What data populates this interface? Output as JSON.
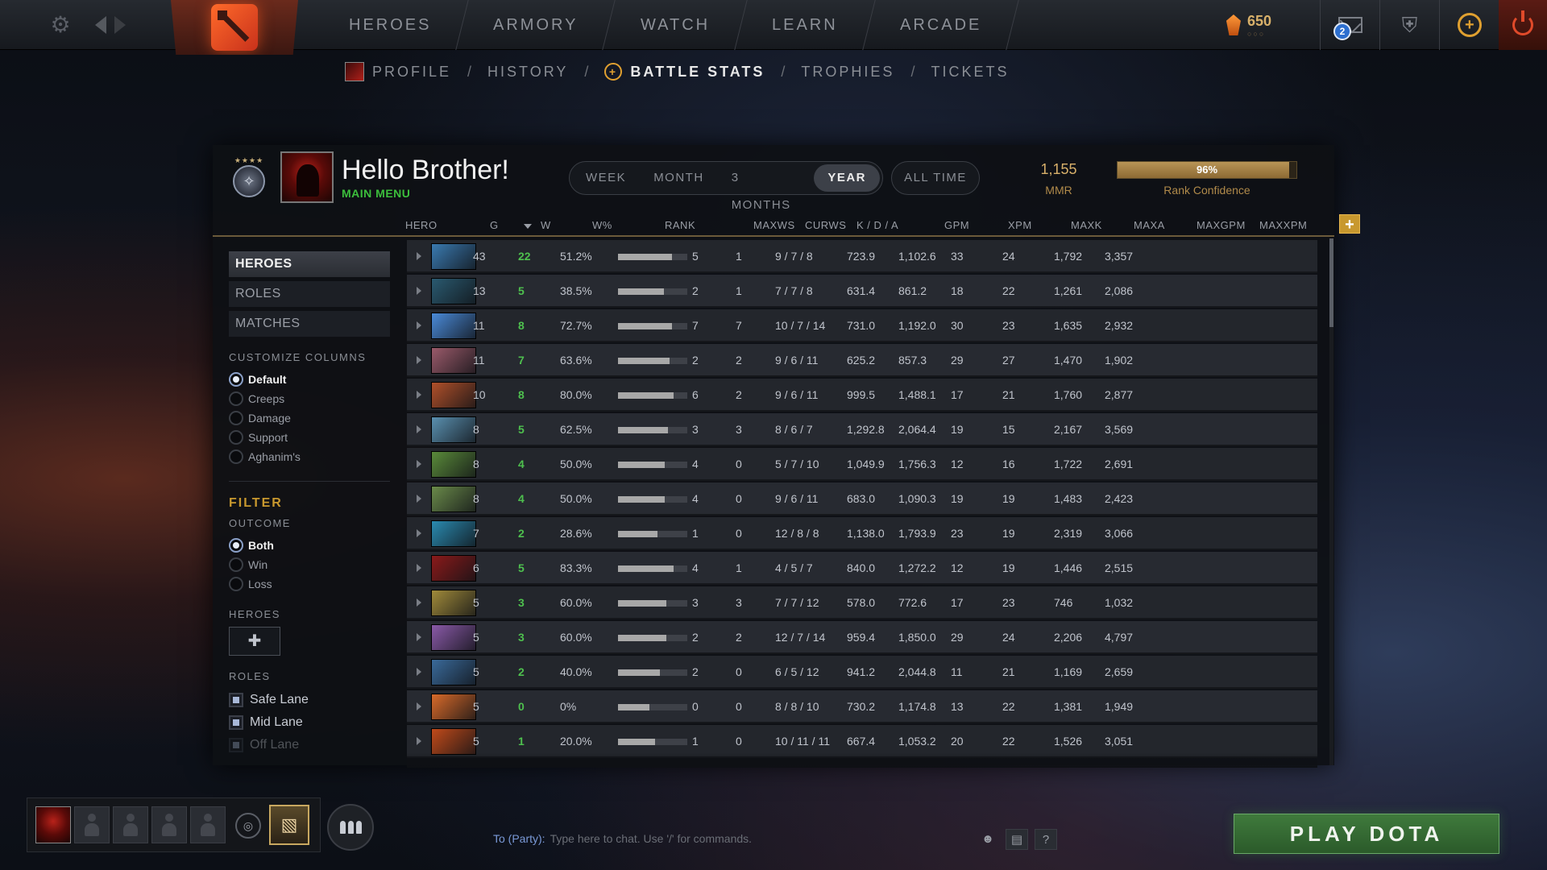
{
  "topnav": {
    "items": [
      "HEROES",
      "ARMORY",
      "WATCH",
      "LEARN",
      "ARCADE"
    ],
    "shards": "650",
    "shard_dots": "○○○",
    "mail_count": "2"
  },
  "subnav": {
    "items": [
      "PROFILE",
      "HISTORY",
      "BATTLE STATS",
      "TROPHIES",
      "TICKETS"
    ],
    "active": "BATTLE STATS",
    "separator": "/"
  },
  "profile": {
    "name": "Hello Brother!",
    "status": "MAIN MENU"
  },
  "periods": {
    "items": [
      "WEEK",
      "MONTH",
      "3 MONTHS",
      "YEAR"
    ],
    "active": "YEAR",
    "all_time": "ALL TIME"
  },
  "mmr": {
    "value": "1,155",
    "label": "MMR",
    "confidence": 0.96,
    "confidence_text": "96%",
    "confidence_label": "Rank Confidence"
  },
  "columns": [
    "HERO",
    "G",
    "W",
    "W%",
    "RANK",
    "MAXWS",
    "CURWS",
    "K / D / A",
    "GPM",
    "XPM",
    "MAXK",
    "MAXA",
    "MAXGPM",
    "MAXXPM"
  ],
  "sidebar": {
    "tabs": [
      "HEROES",
      "ROLES",
      "MATCHES"
    ],
    "active_tab": "HEROES",
    "customize_label": "CUSTOMIZE COLUMNS",
    "customize_options": [
      "Default",
      "Creeps",
      "Damage",
      "Support",
      "Aghanim's"
    ],
    "customize_selected": "Default",
    "filter_label": "FILTER",
    "outcome_label": "OUTCOME",
    "outcome_options": [
      "Both",
      "Win",
      "Loss"
    ],
    "outcome_selected": "Both",
    "heroes_label": "HEROES",
    "roles_label": "ROLES",
    "roles": [
      "Safe Lane",
      "Mid Lane",
      "Off Lane"
    ]
  },
  "rows": [
    {
      "g": "43",
      "w": "22",
      "wp": "51.2%",
      "rank": 0.78,
      "maxws": "5",
      "curws": "1",
      "kda": "9 / 7 / 8",
      "gpm": "723.9",
      "xpm": "1,102.6",
      "maxk": "33",
      "maxa": "24",
      "maxgpm": "1,792",
      "maxxpm": "3,357",
      "color": "#3a7ab0"
    },
    {
      "g": "13",
      "w": "5",
      "wp": "38.5%",
      "rank": 0.66,
      "maxws": "2",
      "curws": "1",
      "kda": "7 / 7 / 8",
      "gpm": "631.4",
      "xpm": "861.2",
      "maxk": "18",
      "maxa": "22",
      "maxgpm": "1,261",
      "maxxpm": "2,086",
      "color": "#2a5a70"
    },
    {
      "g": "11",
      "w": "8",
      "wp": "72.7%",
      "rank": 0.78,
      "maxws": "7",
      "curws": "7",
      "kda": "10 / 7 / 14",
      "gpm": "731.0",
      "xpm": "1,192.0",
      "maxk": "30",
      "maxa": "23",
      "maxgpm": "1,635",
      "maxxpm": "2,932",
      "color": "#4a8ad8"
    },
    {
      "g": "11",
      "w": "7",
      "wp": "63.6%",
      "rank": 0.74,
      "maxws": "2",
      "curws": "2",
      "kda": "9 / 6 / 11",
      "gpm": "625.2",
      "xpm": "857.3",
      "maxk": "29",
      "maxa": "27",
      "maxgpm": "1,470",
      "maxxpm": "1,902",
      "color": "#9a5a6a"
    },
    {
      "g": "10",
      "w": "8",
      "wp": "80.0%",
      "rank": 0.8,
      "maxws": "6",
      "curws": "2",
      "kda": "9 / 6 / 11",
      "gpm": "999.5",
      "xpm": "1,488.1",
      "maxk": "17",
      "maxa": "21",
      "maxgpm": "1,760",
      "maxxpm": "2,877",
      "color": "#b0502a"
    },
    {
      "g": "8",
      "w": "5",
      "wp": "62.5%",
      "rank": 0.72,
      "maxws": "3",
      "curws": "3",
      "kda": "8 / 6 / 7",
      "gpm": "1,292.8",
      "xpm": "2,064.4",
      "maxk": "19",
      "maxa": "15",
      "maxgpm": "2,167",
      "maxxpm": "3,569",
      "color": "#5a90b0"
    },
    {
      "g": "8",
      "w": "4",
      "wp": "50.0%",
      "rank": 0.68,
      "maxws": "4",
      "curws": "0",
      "kda": "5 / 7 / 10",
      "gpm": "1,049.9",
      "xpm": "1,756.3",
      "maxk": "12",
      "maxa": "16",
      "maxgpm": "1,722",
      "maxxpm": "2,691",
      "color": "#5a8a3a"
    },
    {
      "g": "8",
      "w": "4",
      "wp": "50.0%",
      "rank": 0.68,
      "maxws": "4",
      "curws": "0",
      "kda": "9 / 6 / 11",
      "gpm": "683.0",
      "xpm": "1,090.3",
      "maxk": "19",
      "maxa": "19",
      "maxgpm": "1,483",
      "maxxpm": "2,423",
      "color": "#6a8a4a"
    },
    {
      "g": "7",
      "w": "2",
      "wp": "28.6%",
      "rank": 0.57,
      "maxws": "1",
      "curws": "0",
      "kda": "12 / 8 / 8",
      "gpm": "1,138.0",
      "xpm": "1,793.9",
      "maxk": "23",
      "maxa": "19",
      "maxgpm": "2,319",
      "maxxpm": "3,066",
      "color": "#2a8ab0"
    },
    {
      "g": "6",
      "w": "5",
      "wp": "83.3%",
      "rank": 0.8,
      "maxws": "4",
      "curws": "1",
      "kda": "4 / 5 / 7",
      "gpm": "840.0",
      "xpm": "1,272.2",
      "maxk": "12",
      "maxa": "19",
      "maxgpm": "1,446",
      "maxxpm": "2,515",
      "color": "#8a1a1a"
    },
    {
      "g": "5",
      "w": "3",
      "wp": "60.0%",
      "rank": 0.7,
      "maxws": "3",
      "curws": "3",
      "kda": "7 / 7 / 12",
      "gpm": "578.0",
      "xpm": "772.6",
      "maxk": "17",
      "maxa": "23",
      "maxgpm": "746",
      "maxxpm": "1,032",
      "color": "#a08a3a"
    },
    {
      "g": "5",
      "w": "3",
      "wp": "60.0%",
      "rank": 0.7,
      "maxws": "2",
      "curws": "2",
      "kda": "12 / 7 / 14",
      "gpm": "959.4",
      "xpm": "1,850.0",
      "maxk": "29",
      "maxa": "24",
      "maxgpm": "2,206",
      "maxxpm": "4,797",
      "color": "#8a5aa8"
    },
    {
      "g": "5",
      "w": "2",
      "wp": "40.0%",
      "rank": 0.61,
      "maxws": "2",
      "curws": "0",
      "kda": "6 / 5 / 12",
      "gpm": "941.2",
      "xpm": "2,044.8",
      "maxk": "11",
      "maxa": "21",
      "maxgpm": "1,169",
      "maxxpm": "2,659",
      "color": "#3a6a9a"
    },
    {
      "g": "5",
      "w": "0",
      "wp": "0%",
      "rank": 0.45,
      "maxws": "0",
      "curws": "0",
      "kda": "8 / 8 / 10",
      "gpm": "730.2",
      "xpm": "1,174.8",
      "maxk": "13",
      "maxa": "22",
      "maxgpm": "1,381",
      "maxxpm": "1,949",
      "color": "#d86a2a"
    },
    {
      "g": "5",
      "w": "1",
      "wp": "20.0%",
      "rank": 0.53,
      "maxws": "1",
      "curws": "0",
      "kda": "10 / 11 / 11",
      "gpm": "667.4",
      "xpm": "1,053.2",
      "maxk": "20",
      "maxa": "22",
      "maxgpm": "1,526",
      "maxxpm": "3,051",
      "color": "#c04a1a"
    }
  ],
  "bottom": {
    "chat_label": "To (Party):",
    "chat_placeholder": "Type here to chat. Use '/' for commands.",
    "help": "?",
    "play": "PLAY DOTA"
  }
}
